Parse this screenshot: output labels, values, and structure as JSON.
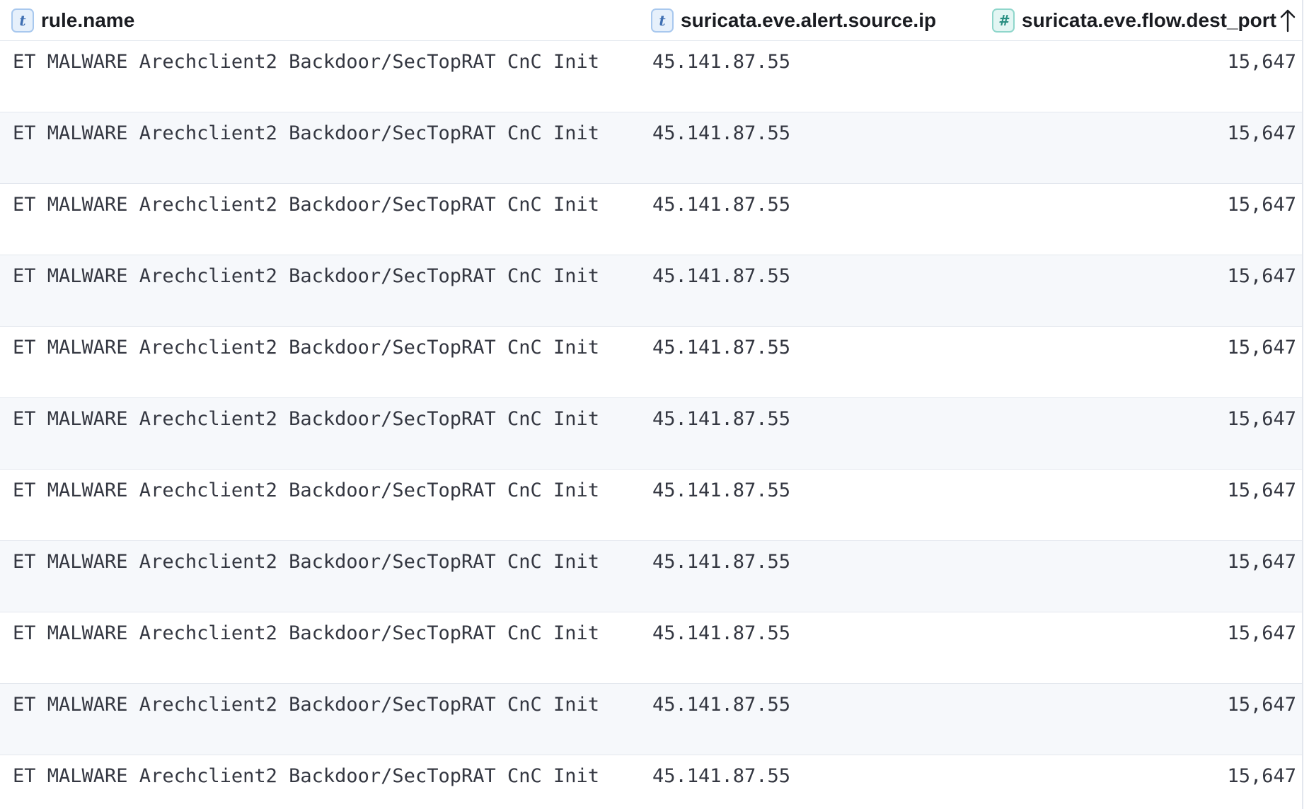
{
  "columns": [
    {
      "name": "rule.name",
      "type_glyph": "t",
      "type": "text"
    },
    {
      "name": "suricata.eve.alert.source.ip",
      "type_glyph": "t",
      "type": "text"
    },
    {
      "name": "suricata.eve.flow.dest_port",
      "type_glyph": "#",
      "type": "number",
      "sort": "ascending",
      "sort_icon": "arrow-up-icon"
    }
  ],
  "rows": [
    {
      "rule_name": "ET MALWARE Arechclient2 Backdoor/SecTopRAT CnC Init",
      "source_ip": "45.141.87.55",
      "dest_port": "15,647"
    },
    {
      "rule_name": "ET MALWARE Arechclient2 Backdoor/SecTopRAT CnC Init",
      "source_ip": "45.141.87.55",
      "dest_port": "15,647"
    },
    {
      "rule_name": "ET MALWARE Arechclient2 Backdoor/SecTopRAT CnC Init",
      "source_ip": "45.141.87.55",
      "dest_port": "15,647"
    },
    {
      "rule_name": "ET MALWARE Arechclient2 Backdoor/SecTopRAT CnC Init",
      "source_ip": "45.141.87.55",
      "dest_port": "15,647"
    },
    {
      "rule_name": "ET MALWARE Arechclient2 Backdoor/SecTopRAT CnC Init",
      "source_ip": "45.141.87.55",
      "dest_port": "15,647"
    },
    {
      "rule_name": "ET MALWARE Arechclient2 Backdoor/SecTopRAT CnC Init",
      "source_ip": "45.141.87.55",
      "dest_port": "15,647"
    },
    {
      "rule_name": "ET MALWARE Arechclient2 Backdoor/SecTopRAT CnC Init",
      "source_ip": "45.141.87.55",
      "dest_port": "15,647"
    },
    {
      "rule_name": "ET MALWARE Arechclient2 Backdoor/SecTopRAT CnC Init",
      "source_ip": "45.141.87.55",
      "dest_port": "15,647"
    },
    {
      "rule_name": "ET MALWARE Arechclient2 Backdoor/SecTopRAT CnC Init",
      "source_ip": "45.141.87.55",
      "dest_port": "15,647"
    },
    {
      "rule_name": "ET MALWARE Arechclient2 Backdoor/SecTopRAT CnC Init",
      "source_ip": "45.141.87.55",
      "dest_port": "15,647"
    },
    {
      "rule_name": "ET MALWARE Arechclient2 Backdoor/SecTopRAT CnC Init",
      "source_ip": "45.141.87.55",
      "dest_port": "15,647"
    }
  ],
  "colors": {
    "text_badge_bg": "#e6f0fb",
    "number_badge_bg": "#e3f6f3",
    "alt_row_bg": "#f6f8fb",
    "border": "#e3e7ee"
  }
}
